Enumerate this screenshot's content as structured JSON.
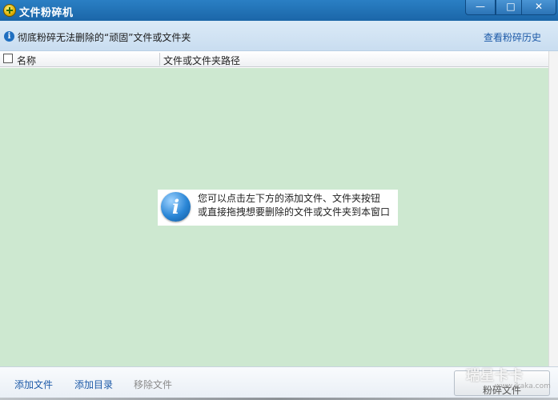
{
  "window": {
    "title": "文件粉碎机",
    "controls": {
      "minimize": "—",
      "maximize": "□",
      "close": "✕"
    }
  },
  "infobar": {
    "text": "彻底粉碎无法删除的“顽固”文件或文件夹",
    "history_link": "查看粉碎历史"
  },
  "table": {
    "columns": [
      "名称",
      "文件或文件夹路径"
    ],
    "rows": []
  },
  "hint": {
    "line1": "您可以点击左下方的添加文件、文件夹按钮",
    "line2": "或直接拖拽想要删除的文件或文件夹到本窗口"
  },
  "bottom": {
    "add_file": "添加文件",
    "add_dir": "添加目录",
    "remove_file": "移除文件",
    "shred": "粉碎文件"
  },
  "watermark": {
    "brand": "瑞星卡卡",
    "url": "www.ikaka.com"
  },
  "colors": {
    "titlebar": "#1b66a8",
    "list_background": "#cde8d0",
    "link": "#1d5aa8",
    "disabled": "#8a8a8a"
  },
  "icons": [
    "app-shredder-icon",
    "info-icon",
    "info-large-icon",
    "minimize-icon",
    "maximize-icon",
    "close-icon"
  ]
}
